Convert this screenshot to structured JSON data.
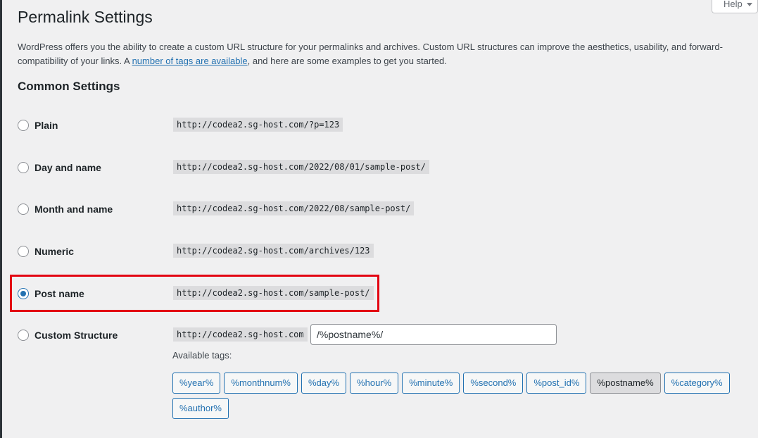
{
  "help": {
    "label": "Help"
  },
  "page": {
    "title": "Permalink Settings",
    "intro_before_link": "WordPress offers you the ability to create a custom URL structure for your permalinks and archives. Custom URL structures can improve the aesthetics, usability, and forward-compatibility of your links. A ",
    "intro_link": "number of tags are available",
    "intro_after_link": ", and here are some examples to get you started."
  },
  "common_settings": {
    "title": "Common Settings",
    "selected": "Post name",
    "options": [
      {
        "label": "Plain",
        "example": "http://codea2.sg-host.com/?p=123",
        "checked": false
      },
      {
        "label": "Day and name",
        "example": "http://codea2.sg-host.com/2022/08/01/sample-post/",
        "checked": false
      },
      {
        "label": "Month and name",
        "example": "http://codea2.sg-host.com/2022/08/sample-post/",
        "checked": false
      },
      {
        "label": "Numeric",
        "example": "http://codea2.sg-host.com/archives/123",
        "checked": false
      },
      {
        "label": "Post name",
        "example": "http://codea2.sg-host.com/sample-post/",
        "checked": true
      },
      {
        "label": "Custom Structure",
        "example": "http://codea2.sg-host.com",
        "checked": false
      }
    ],
    "custom_structure_value": "/%postname%/",
    "available_tags_label": "Available tags:",
    "tags": [
      "%year%",
      "%monthnum%",
      "%day%",
      "%hour%",
      "%minute%",
      "%second%",
      "%post_id%",
      "%postname%",
      "%category%",
      "%author%"
    ],
    "active_tag": "%postname%"
  },
  "colors": {
    "accent": "#2271b1",
    "highlight": "#e30613",
    "background": "#f0f0f1"
  }
}
